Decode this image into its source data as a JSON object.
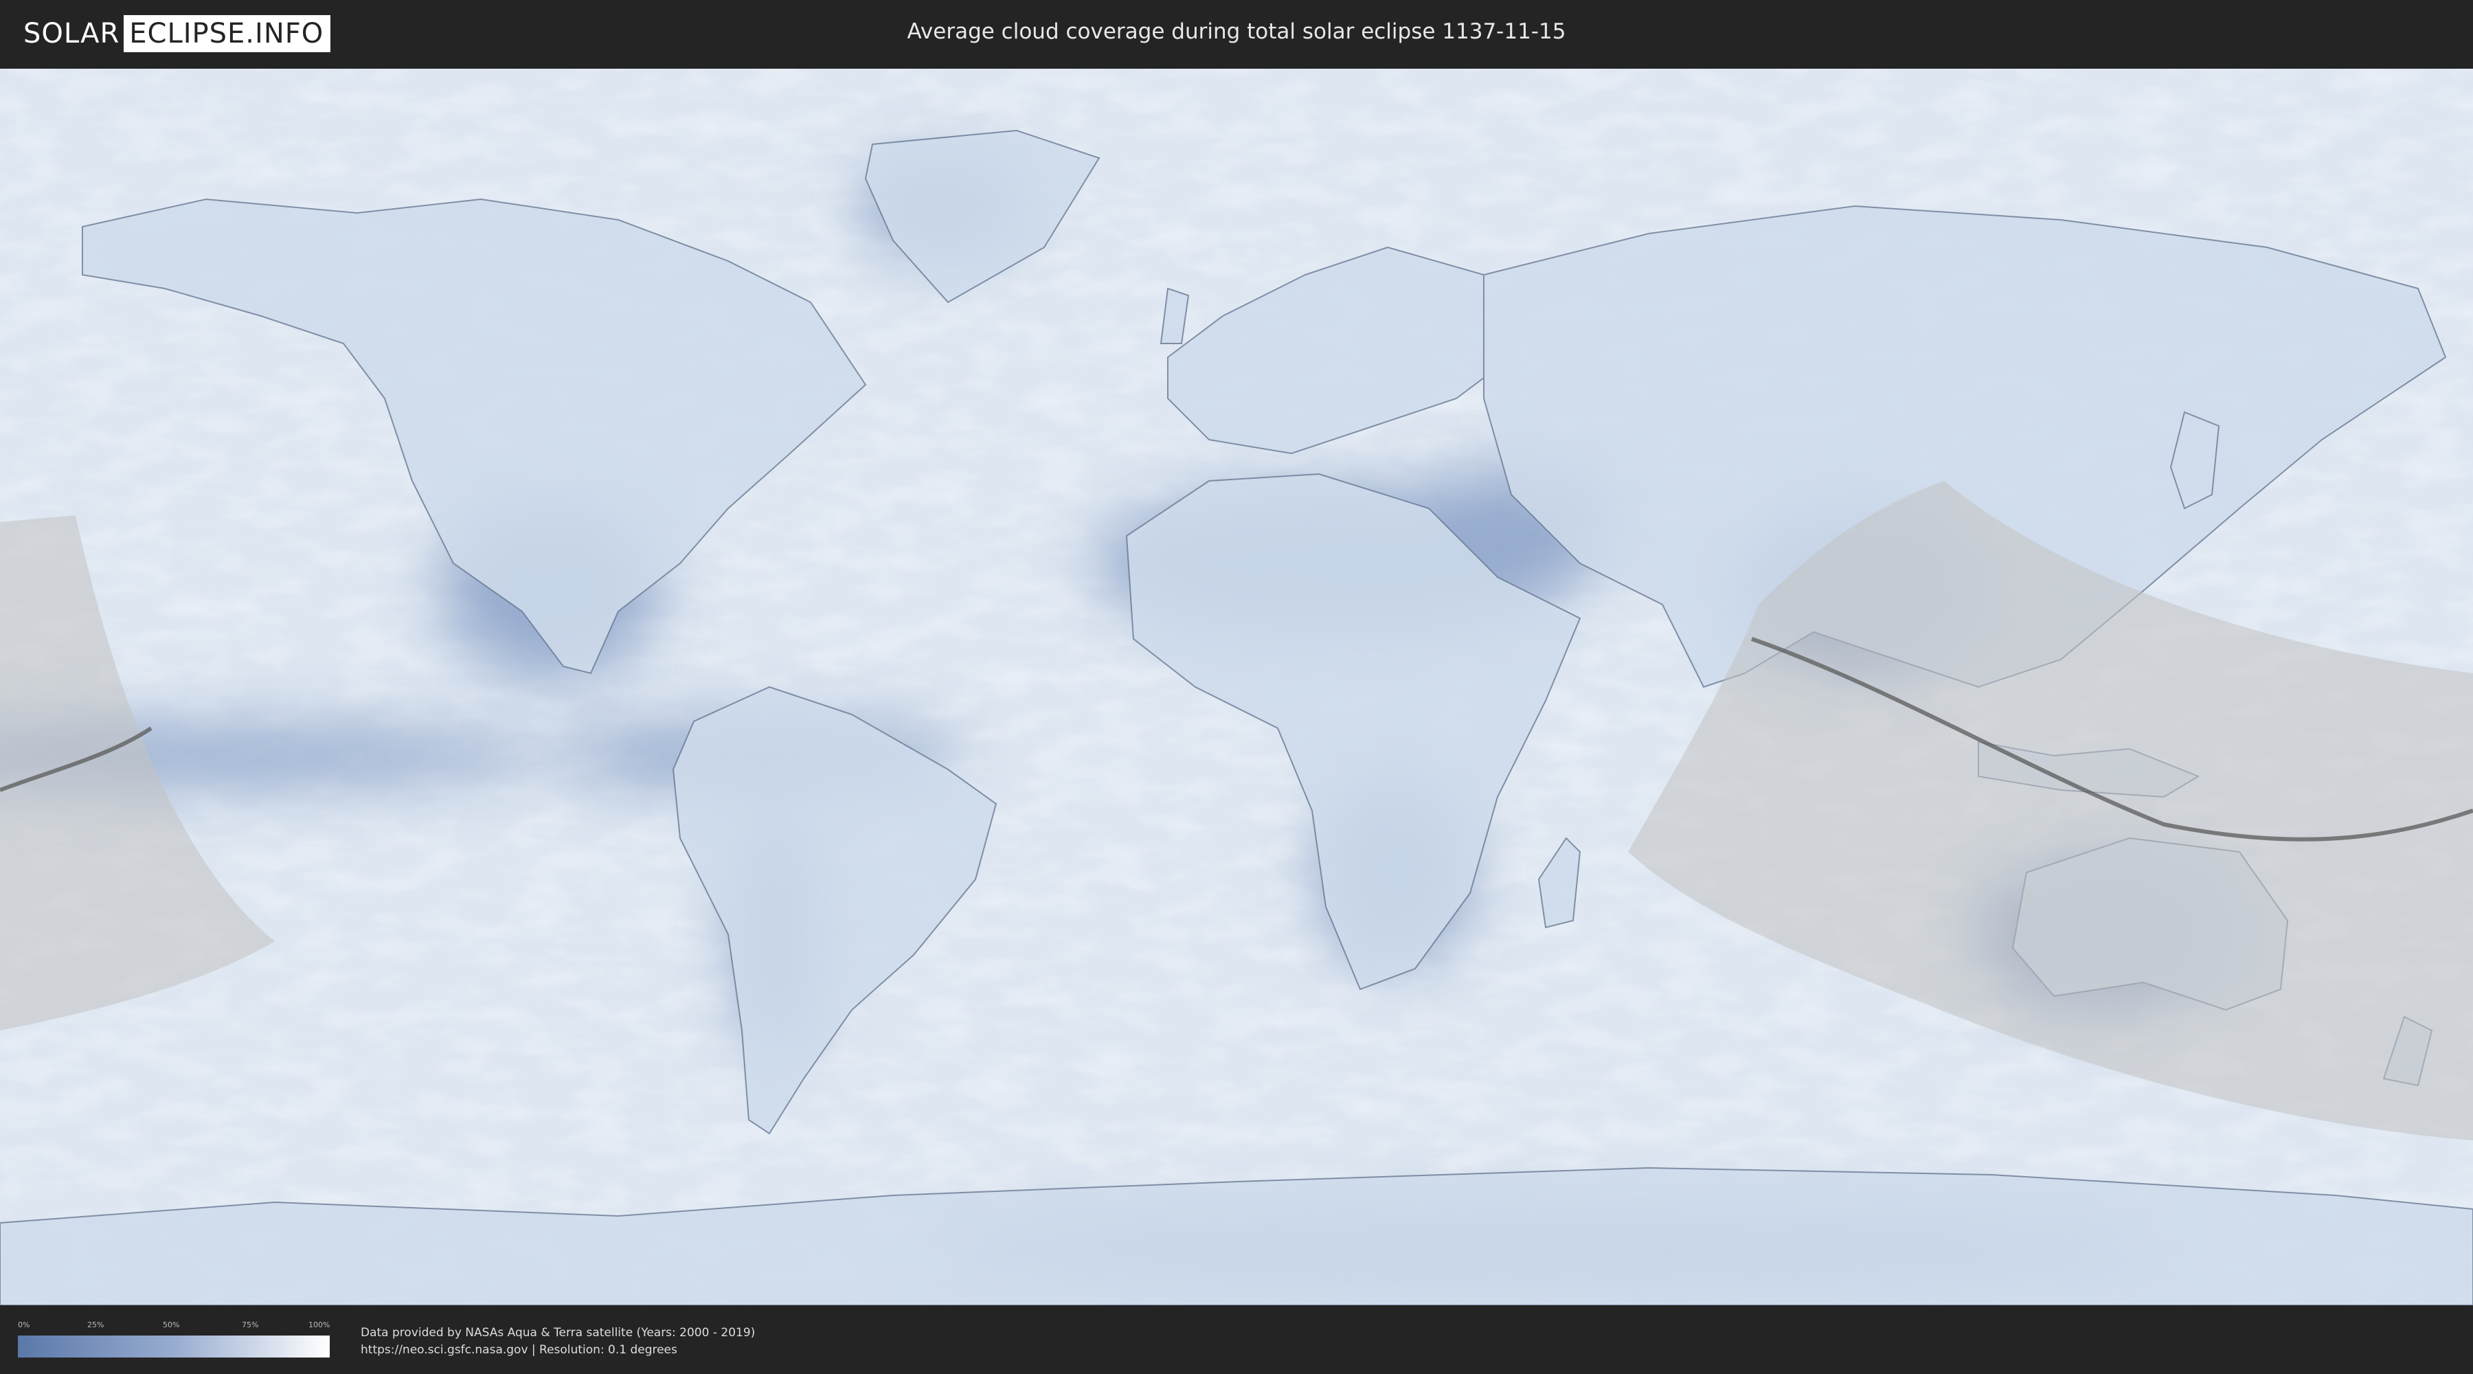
{
  "header": {
    "logo_part1": "SOLAR",
    "logo_part2": "ECLIPSE.INFO",
    "title": "Average cloud coverage during total solar eclipse 1137-11-15"
  },
  "legend": {
    "ticks": [
      "0%",
      "25%",
      "50%",
      "75%",
      "100%"
    ],
    "color_low": "#5a78a8",
    "color_high": "#ffffff"
  },
  "footer": {
    "credit_line1": "Data provided by NASAs Aqua & Terra satellite (Years: 2000 - 2019)",
    "credit_line2": "https://neo.sci.gsfc.nasa.gov | Resolution: 0.1 degrees"
  },
  "map": {
    "projection": "equirectangular",
    "ocean_color": "#dfe7f2",
    "cloud_low_color": "#5a78a8",
    "eclipse_shade_color": "#c8c8c8"
  }
}
